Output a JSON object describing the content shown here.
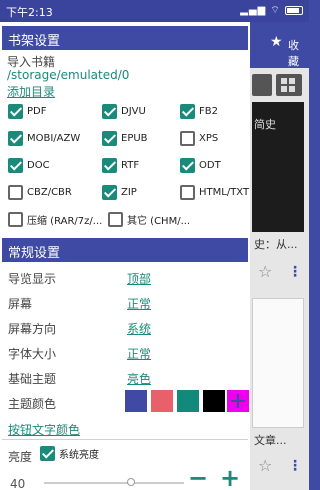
{
  "status_bar": {
    "time": "下午2:13",
    "icons": "▂▄▆ ⌔"
  },
  "background": {
    "favorites_label": "收藏",
    "book1_title": "简史",
    "book1_caption": "史：从...",
    "book2_caption": "文章..."
  },
  "dialog": {
    "shelf_header": "书架设置",
    "import_label": "导入书籍",
    "import_path": "/storage/emulated/0",
    "add_dir": "添加目录",
    "formats": [
      {
        "label": "PDF",
        "checked": true
      },
      {
        "label": "DJVU",
        "checked": true
      },
      {
        "label": "FB2",
        "checked": true
      },
      {
        "label": "MOBI/AZW",
        "checked": true
      },
      {
        "label": "EPUB",
        "checked": true
      },
      {
        "label": "XPS",
        "checked": false
      },
      {
        "label": "DOC",
        "checked": true
      },
      {
        "label": "RTF",
        "checked": true
      },
      {
        "label": "ODT",
        "checked": true
      },
      {
        "label": "CBZ/CBR",
        "checked": false
      },
      {
        "label": "ZIP",
        "checked": true
      },
      {
        "label": "HTML/TXT",
        "checked": false
      },
      {
        "label": "压缩 (RAR/7z/...",
        "checked": false
      },
      {
        "label": "其它 (CHM/...",
        "checked": false
      }
    ],
    "general_header": "常规设置",
    "settings": [
      {
        "label": "导览显示",
        "value": "顶部"
      },
      {
        "label": "屏幕",
        "value": "正常"
      },
      {
        "label": "屏幕方向",
        "value": "系统"
      },
      {
        "label": "字体大小",
        "value": "正常"
      },
      {
        "label": "基础主题",
        "value": "亮色"
      }
    ],
    "theme_color_label": "主题颜色",
    "theme_colors": [
      "#3f4aa5",
      "#e8606a",
      "#12897a",
      "#000000"
    ],
    "button_text_color": "按钮文字颜色",
    "brightness_label": "亮度",
    "system_brightness": "系统亮度",
    "system_brightness_checked": true,
    "brightness_value": "40",
    "brightness_fraction": 0.62,
    "minus_label": "−",
    "plus_label": "+"
  }
}
